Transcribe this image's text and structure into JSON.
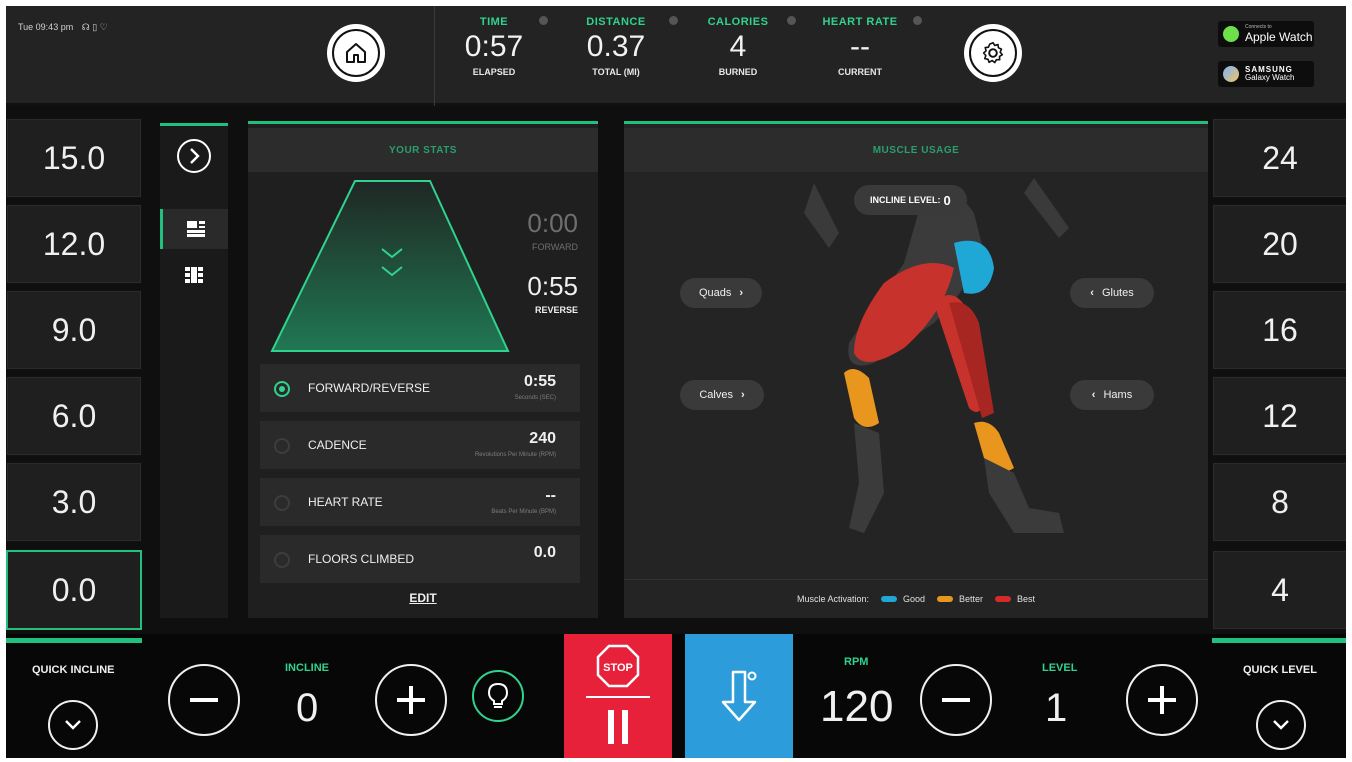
{
  "status_bar": {
    "text": "Tue 09:43 pm"
  },
  "metrics": [
    {
      "label": "TIME",
      "value": "0:57",
      "sub": "ELAPSED"
    },
    {
      "label": "DISTANCE",
      "value": "0.37",
      "sub": "TOTAL (MI)"
    },
    {
      "label": "CALORIES",
      "value": "4",
      "sub": "BURNED"
    },
    {
      "label": "HEART RATE",
      "value": "--",
      "sub": "CURRENT"
    }
  ],
  "watches": {
    "apple_small": "Connects to",
    "apple": "Apple Watch",
    "samsung_top": "SAMSUNG",
    "samsung_bottom": "Galaxy Watch"
  },
  "incline_presets": [
    "15.0",
    "12.0",
    "9.0",
    "6.0",
    "3.0",
    "0.0"
  ],
  "level_presets": [
    "24",
    "20",
    "16",
    "12",
    "8",
    "4"
  ],
  "your_stats": {
    "title": "YOUR STATS",
    "forward_time": "0:00",
    "forward_label": "FORWARD",
    "reverse_time": "0:55",
    "reverse_label": "REVERSE",
    "rows": [
      {
        "name": "FORWARD/REVERSE",
        "value": "0:55",
        "unit": "Seconds (SEC)"
      },
      {
        "name": "CADENCE",
        "value": "240",
        "unit": "Revolutions Per Minute (RPM)"
      },
      {
        "name": "HEART RATE",
        "value": "--",
        "unit": "Beats Per Minute (BPM)"
      },
      {
        "name": "FLOORS CLIMBED",
        "value": "0.0",
        "unit": ""
      }
    ],
    "edit_label": "EDIT"
  },
  "muscle_usage": {
    "title": "MUSCLE USAGE",
    "incline_level_label": "INCLINE LEVEL:",
    "incline_level_value": "0",
    "quads": "Quads",
    "calves": "Calves",
    "glutes": "Glutes",
    "hams": "Hams",
    "legend_title": "Muscle Activation:",
    "legend": [
      {
        "label": "Good",
        "color": "#1fa8d6"
      },
      {
        "label": "Better",
        "color": "#e8961e"
      },
      {
        "label": "Best",
        "color": "#d62a2a"
      }
    ]
  },
  "bottom": {
    "quick_incline": "QUICK INCLINE",
    "incline_label": "INCLINE",
    "incline_value": "0",
    "stop_label": "STOP",
    "rpm_label": "RPM",
    "rpm_value": "120",
    "level_label": "LEVEL",
    "level_value": "1",
    "quick_level": "QUICK LEVEL"
  },
  "colors": {
    "accent": "#22c07e",
    "stop": "#e8213a",
    "reverse": "#2d9cdb"
  },
  "icons": [
    "home-icon",
    "gear-icon",
    "chevron-right-icon",
    "stats-view-icon",
    "grid-view-icon",
    "chevron-down-icon",
    "minus-icon",
    "plus-icon",
    "lightbulb-icon",
    "stop-sign-icon",
    "pause-icon",
    "reverse-arrow-icon"
  ]
}
